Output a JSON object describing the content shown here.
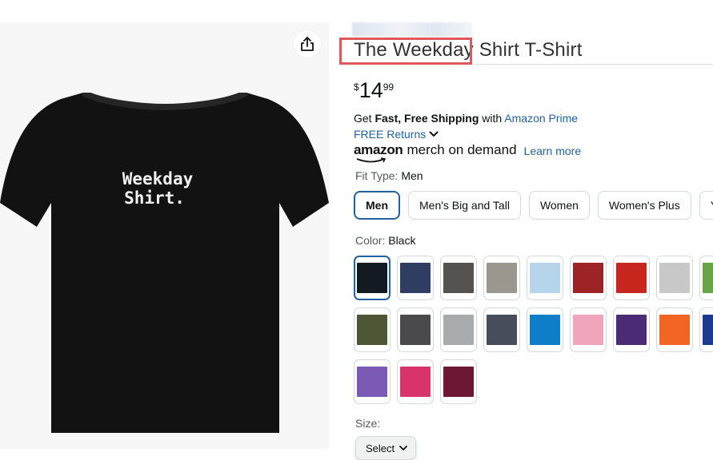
{
  "product": {
    "title_highlighted": "The Weekday",
    "title_rest": " Shirt T-Shirt",
    "shirt_print_line1": "Weekday",
    "shirt_print_line2": "Shirt."
  },
  "price": {
    "symbol": "$",
    "whole": "14",
    "fraction": "99"
  },
  "shipping": {
    "prefix": "Get ",
    "bold": "Fast, Free Shipping",
    "middle": " with ",
    "link": "Amazon Prime",
    "returns": "FREE Returns"
  },
  "merch": {
    "logo": "amazon",
    "text": "merch on demand",
    "learn_more": "Learn more"
  },
  "fit": {
    "label": "Fit Type: ",
    "selected": "Men",
    "options": [
      "Men",
      "Men's Big and Tall",
      "Women",
      "Women's Plus",
      "Y"
    ]
  },
  "color": {
    "label": "Color: ",
    "selected": "Black",
    "swatches": [
      "#131a22",
      "#2f3d63",
      "#54534f",
      "#9b978f",
      "#b5d6ea",
      "#9c2426",
      "#c8271f",
      "#c8c8c8",
      "#6aa449",
      "#4d5735",
      "#4a4a4c",
      "#a9aaac",
      "#474d5b",
      "#0e7ec8",
      "#f0a5bd",
      "#4b2a76",
      "#f26522",
      "#1c3a8e",
      "#7a5ab5",
      "#d8336b",
      "#6d1734"
    ]
  },
  "size": {
    "label": "Size:",
    "select": "Select"
  },
  "icons": {
    "share": "share-icon",
    "chevron": "chevron-down-icon"
  },
  "colors": {
    "link": "#2162a1",
    "highlight": "#e0575b",
    "selected_border": "#2162a1"
  }
}
